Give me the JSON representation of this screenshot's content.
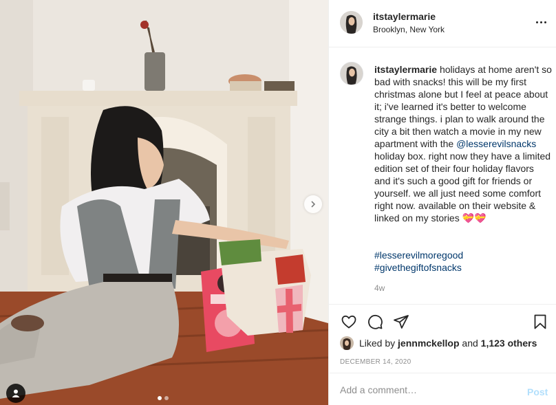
{
  "post": {
    "username": "itstaylermarie",
    "location": "Brooklyn, New York",
    "caption": {
      "username": "itstaylermarie",
      "text_before_mention": " holidays at home aren't so bad with snacks! this will be my first christmas alone but I feel at peace about it; i've learned it's better to welcome strange things. i plan to walk around the city a bit then watch a movie in my new apartment with the ",
      "mention": "@lesserevilsnacks",
      "text_after_mention": " holiday box. right now they have a limited edition set of their four holiday flavors and it's such a good gift for friends or yourself. we all just need some comfort right now. available on their website & linked on my stories 💝💝"
    },
    "hashtags": [
      "#lesserevilmoregood",
      "#givethegiftofsnacks"
    ],
    "time_ago": "4w",
    "likes": {
      "prefix": "Liked by",
      "user": "jennmckellop",
      "connector": "and",
      "others": "1,123 others"
    },
    "date": "DECEMBER 14, 2020",
    "comment": {
      "placeholder": "Add a comment…",
      "value": "",
      "post_label": "Post"
    },
    "carousel": {
      "current_slide": 1,
      "total_slides": 2
    }
  },
  "colors": {
    "link": "#00376b",
    "muted": "#8e8e8e",
    "post_button_disabled": "#b2dffc",
    "border": "#efefef"
  },
  "icons": {
    "more": "more-options-icon",
    "like": "heart-icon",
    "comment": "comment-icon",
    "share": "paper-plane-icon",
    "save": "bookmark-icon",
    "next": "chevron-right-icon",
    "tag": "user-tag-icon"
  }
}
